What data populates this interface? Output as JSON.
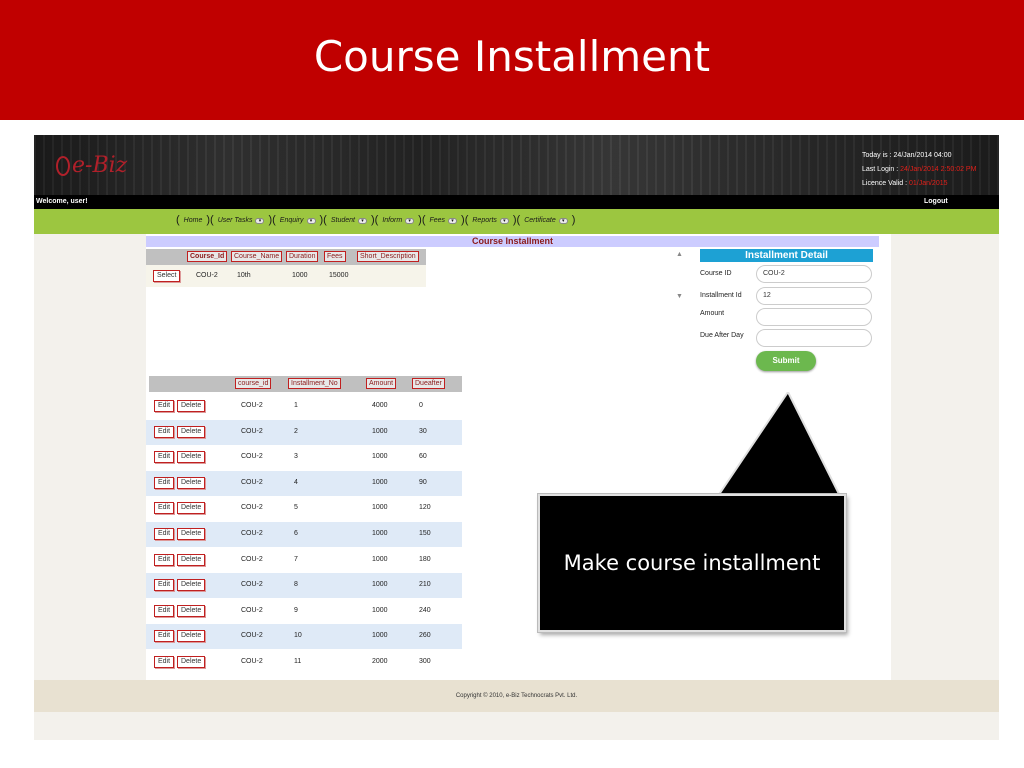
{
  "slide": {
    "title": "Course Installment"
  },
  "app": {
    "logo": "e-Biz",
    "info": {
      "today_label": "Today is :",
      "today_value": "24/Jan/2014 04:00",
      "last_login_label": "Last Login :",
      "last_login_value": "24/Jan/2014 2:50:02 PM",
      "licence_label": "Licence Valid :",
      "licence_value": "01/Jan/2015"
    },
    "welcome": "Welcome,  user!",
    "logout": "Logout",
    "nav": [
      {
        "label": "Home",
        "dropdown": false
      },
      {
        "label": "User Tasks",
        "dropdown": true
      },
      {
        "label": "Enquiry",
        "dropdown": true
      },
      {
        "label": "Student",
        "dropdown": true
      },
      {
        "label": "Inform",
        "dropdown": true
      },
      {
        "label": "Fees",
        "dropdown": true
      },
      {
        "label": "Reports",
        "dropdown": true
      },
      {
        "label": "Certificate",
        "dropdown": true
      }
    ],
    "page_heading": "Course Installment",
    "course_table": {
      "headers": [
        "Course_Id",
        "Course_Name",
        "Duration",
        "Fees",
        "Short_Description"
      ],
      "select_label": "Select",
      "row": [
        "COU-2",
        "10th",
        "1000",
        "15000",
        ""
      ]
    },
    "installment_detail": {
      "title": "Installment Detail",
      "fields": [
        {
          "label": "Course ID",
          "value": "COU-2"
        },
        {
          "label": "Installment Id",
          "value": "12"
        },
        {
          "label": "Amount",
          "value": ""
        },
        {
          "label": "Due After Day",
          "value": ""
        }
      ],
      "submit": "Submit"
    },
    "installment_table": {
      "headers": [
        "course_id",
        "Installment_No",
        "Amount",
        "Dueafter"
      ],
      "edit_label": "Edit",
      "delete_label": "Delete",
      "rows": [
        [
          "COU-2",
          "1",
          "4000",
          "0"
        ],
        [
          "COU-2",
          "2",
          "1000",
          "30"
        ],
        [
          "COU-2",
          "3",
          "1000",
          "60"
        ],
        [
          "COU-2",
          "4",
          "1000",
          "90"
        ],
        [
          "COU-2",
          "5",
          "1000",
          "120"
        ],
        [
          "COU-2",
          "6",
          "1000",
          "150"
        ],
        [
          "COU-2",
          "7",
          "1000",
          "180"
        ],
        [
          "COU-2",
          "8",
          "1000",
          "210"
        ],
        [
          "COU-2",
          "9",
          "1000",
          "240"
        ],
        [
          "COU-2",
          "10",
          "1000",
          "260"
        ],
        [
          "COU-2",
          "11",
          "2000",
          "300"
        ]
      ]
    },
    "footer": "Copyright © 2010, e-Biz Technocrats Pvt. Ltd."
  },
  "callout": {
    "text": "Make course installment"
  },
  "colors": {
    "header": "#c00000",
    "nav": "#9cc640",
    "detail_title": "#1da1d4",
    "submit": "#6cb84e",
    "row_alt": "#dfeaf7"
  }
}
